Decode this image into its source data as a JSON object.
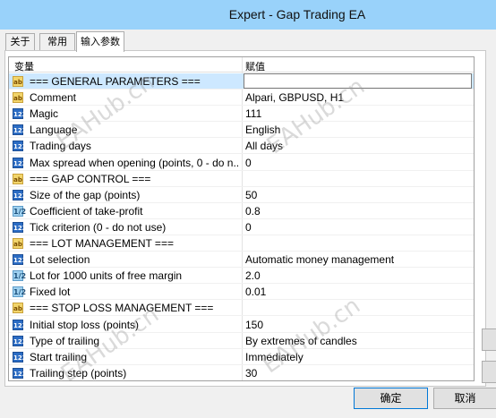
{
  "window": {
    "title": "Expert - Gap Trading EA"
  },
  "tabs": [
    {
      "label": "关于"
    },
    {
      "label": "常用"
    },
    {
      "label": "输入参数"
    }
  ],
  "grid": {
    "col_variable": "变量",
    "col_value": "赋值",
    "rows": [
      {
        "type": "ab",
        "name": "=== GENERAL PARAMETERS ===",
        "value": ""
      },
      {
        "type": "ab",
        "name": "Comment",
        "value": "Alpari, GBPUSD, H1"
      },
      {
        "type": "num",
        "name": "Magic",
        "value": "111"
      },
      {
        "type": "num",
        "name": "Language",
        "value": "English"
      },
      {
        "type": "num",
        "name": "Trading days",
        "value": "All days"
      },
      {
        "type": "num",
        "name": "Max spread when opening (points, 0 - do n...",
        "value": "0"
      },
      {
        "type": "ab",
        "name": "=== GAP CONTROL ===",
        "value": ""
      },
      {
        "type": "num",
        "name": "Size of the gap (points)",
        "value": "50"
      },
      {
        "type": "dbl",
        "name": "Coefficient of take-profit",
        "value": "0.8"
      },
      {
        "type": "num",
        "name": "Tick criterion (0 - do not use)",
        "value": "0"
      },
      {
        "type": "ab",
        "name": "=== LOT MANAGEMENT ===",
        "value": ""
      },
      {
        "type": "num",
        "name": "Lot selection",
        "value": "Automatic money management"
      },
      {
        "type": "dbl",
        "name": "Lot for 1000 units of free margin",
        "value": "2.0"
      },
      {
        "type": "dbl",
        "name": "Fixed lot",
        "value": "0.01"
      },
      {
        "type": "ab",
        "name": "=== STOP LOSS MANAGEMENT ===",
        "value": ""
      },
      {
        "type": "num",
        "name": "Initial stop loss (points)",
        "value": "150"
      },
      {
        "type": "num",
        "name": "Type of trailing",
        "value": "By extremes of candles"
      },
      {
        "type": "num",
        "name": "Start trailing",
        "value": "Immediately"
      },
      {
        "type": "num",
        "name": "Trailing step (points)",
        "value": "30"
      }
    ]
  },
  "buttons": {
    "ok": "确定",
    "cancel": "取消"
  },
  "icons": {
    "ab": "ab",
    "num": "123",
    "dbl": "1/2"
  },
  "watermark": "EAHub.cn",
  "colors": {
    "titlebar": "#99d2fa",
    "selected_row": "#cde8ff"
  }
}
